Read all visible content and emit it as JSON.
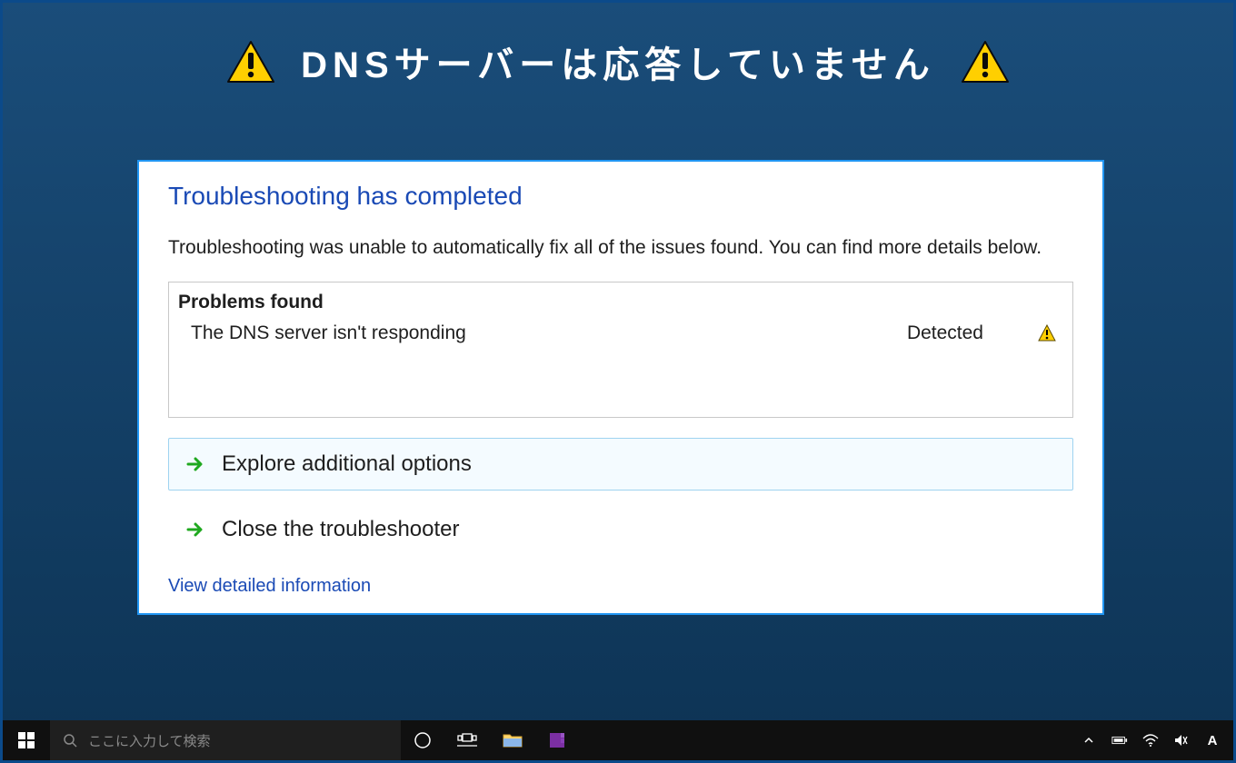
{
  "banner": {
    "title": "DNSサーバーは応答していません"
  },
  "dialog": {
    "title": "Troubleshooting has completed",
    "description": "Troubleshooting was unable to automatically fix all of the issues found. You can find more details below.",
    "problems_header": "Problems found",
    "problems": [
      {
        "text": "The DNS server isn't responding",
        "status": "Detected"
      }
    ],
    "options": [
      {
        "label": "Explore additional options"
      },
      {
        "label": "Close the troubleshooter"
      }
    ],
    "view_detail": "View detailed information"
  },
  "taskbar": {
    "search_placeholder": "ここに入力して検索",
    "ime_indicator": "A"
  }
}
